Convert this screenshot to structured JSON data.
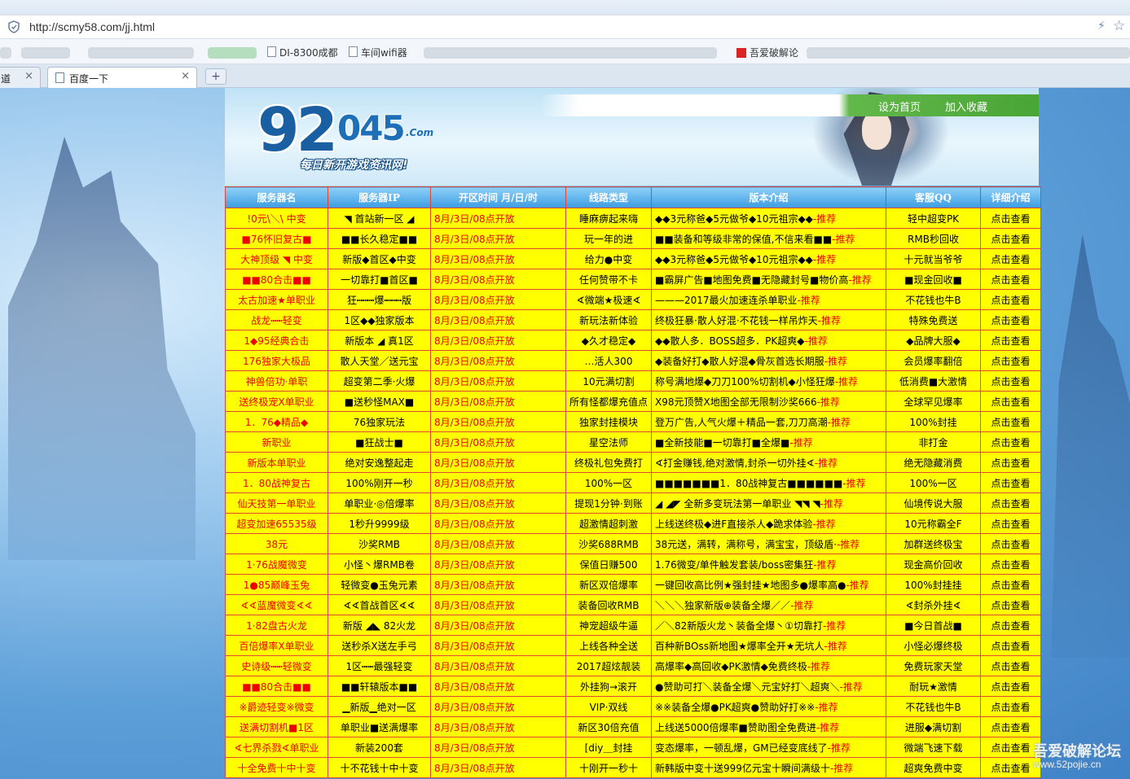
{
  "browser": {
    "url": "http://scmy58.com/jj.html",
    "bookmarks": [
      "DI-8300成都",
      "车间wifi器",
      "吾爱破解论"
    ],
    "tab_prev_label": "道",
    "tab_active_label": "百度一下",
    "new_tab": "+",
    "close": "×"
  },
  "site": {
    "logo_main": "92",
    "logo_num": "045",
    "logo_com": ".Com",
    "slogan": "每日新开游戏资讯网!",
    "nav": [
      "设为首页",
      "加入收藏"
    ]
  },
  "table": {
    "headers": [
      "服务器名",
      "服务器IP",
      "开区时间 月/日/时",
      "线路类型",
      "版本介绍",
      "客服QQ",
      "详细介绍"
    ],
    "rec_suffix": "-推荐",
    "rows": [
      [
        "!0元\\＼\\ 中变",
        "◥ 首站新一区 ◢",
        "8月/3日/08点开放",
        "睡麻痹起来嗨",
        "◆◆3元称爸◆5元做爷◆10元祖宗◆◆",
        "轻中超变PK",
        "点击查看"
      ],
      [
        "■76怀旧复古■",
        "■■长久稳定■■",
        "8月/3日/08点开放",
        "玩一年的进",
        "■■装备和等级非常的保值,不信来看■■",
        "RMB秒回收",
        "点击查看"
      ],
      [
        "大神顶级 ◥ 中变",
        "新版◆首区◆中变",
        "8月/3日/08点开放",
        "给力●中变",
        "◆◆3元称爸◆5元做爷◆10元祖宗◆◆",
        "十元就当爷爷",
        "点击查看"
      ],
      [
        "■■80合击■■",
        "一切靠打■首区■",
        "8月/3日/08点开放",
        "任何赞带不卡",
        "■霸屏广告■地图免费■无隐藏封号■物价高",
        "■现金回收■",
        "点击查看"
      ],
      [
        "太古加速★单职业",
        "狂┅┅┅爆┅┅┅版",
        "8月/3日/08点开放",
        "∢微端★极速∢",
        "———2017最火加速连杀单职业",
        "不花钱也牛B",
        "点击查看"
      ],
      [
        "战龙┅┅轻变",
        "1区◆◆独家版本",
        "8月/3日/08点开放",
        "新玩法新体验",
        "终极狂暴·散人好混·不花钱一样吊炸天",
        "特殊免费送",
        "点击查看"
      ],
      [
        "1◆95经典合击",
        "新版本 ◢ 真1区",
        "8月/3日/08点开放",
        "◆久才稳定◆",
        "◆◆散人多．BOSS超多．PK超爽◆",
        "◆品牌大服◆",
        "点击查看"
      ],
      [
        "176独家大极品",
        "散人天堂／送元宝",
        "8月/3日/08点开放",
        "…活人300",
        "◆装备好打◆散人好混◆骨灰首选长期服",
        "会员爆率翻倍",
        "点击查看"
      ],
      [
        "神兽倍功·单职",
        "超变第二季·火爆",
        "8月/3日/08点开放",
        "10元满切割",
        "称号满地爆◆刀刀100%切割机◆小怪狂爆",
        "低消费■大激情",
        "点击查看"
      ],
      [
        "送终极宠X单职业",
        "■送秒怪MAX■",
        "8月/3日/08点开放",
        "所有怪都爆充值点",
        "X98元顶赞X地图全部无限制沙奖666",
        "全球罕见爆率",
        "点击查看"
      ],
      [
        "1．76◆精品◆",
        "76独家玩法",
        "8月/3日/08点开放",
        "独家封挂模块",
        "登万广告,人气火爆＋精品一套,刀刀高潮",
        "100%封挂",
        "点击查看"
      ],
      [
        "新职业",
        "■狂战士■",
        "8月/3日/08点开放",
        "星空法师",
        "■全新技能■一切靠打■全爆■",
        "非打金",
        "点击查看"
      ],
      [
        "新版本单职业",
        "绝对安逸整起走",
        "8月/3日/08点开放",
        "终极礼包免费打",
        "∢打金赚钱,绝对激情,封杀一切外挂∢",
        "绝无隐藏消费",
        "点击查看"
      ],
      [
        "1．80战神复古",
        "100%刚开一秒",
        "8月/3日/08点开放",
        "100%一区",
        "■■■■■■■1．80战神复古■■■■■■",
        "100%一区",
        "点击查看"
      ],
      [
        "仙天技第一单职业",
        "单职业·◎倍爆率",
        "8月/3日/08点开放",
        "提现1分钟·到账",
        "◢ ◢◤ 全新多变玩法第一单职业 ◥◥ ◥",
        "仙境传说大服",
        "点击查看"
      ],
      [
        "超变加速65535级",
        "1秒升9999级",
        "8月/3日/08点开放",
        "超激情超刺激",
        "上线送终极◆进F直接杀人◆跪求体验",
        "10元称霸全F",
        "点击查看"
      ],
      [
        "38元",
        "沙奖RMB",
        "8月/3日/08点开放",
        "沙奖688RMB",
        "38元送，满转，满称号，满宝宝，顶级盾·",
        "加群送终极宝",
        "点击查看"
      ],
      [
        "1·76战魔微变",
        "小怪丶爆RMB卷",
        "8月/3日/08点开放",
        "保值日赚500",
        "1.76微变/单件触发套装/boss密集狂",
        "现金高价回收",
        "点击查看"
      ],
      [
        "1●85巅峰玉兔",
        "轻微变●玉兔元素",
        "8月/3日/08点开放",
        "新区双倍爆率",
        "一键回收高比例★强封挂★地图多●爆率高●",
        "100%封挂挂",
        "点击查看"
      ],
      [
        "∢∢蓝魔微变∢∢",
        "∢∢首战首区∢∢",
        "8月/3日/08点开放",
        "装备回收RMB",
        "＼＼＼独家新版⊕装备全爆／／",
        "∢封杀外挂∢",
        "点击查看"
      ],
      [
        "1·82盘古火龙",
        "新版 ◢◣ 82火龙",
        "8月/3日/08点开放",
        "神宠超级牛逼",
        "／＼82新版火龙丶装备全爆丶①切靠打",
        "■今日首战■",
        "点击查看"
      ],
      [
        "百倍爆率X单职业",
        "送秒杀X送左手弓",
        "8月/3日/08点开放",
        "上线各种全送",
        "百种新BOss新地图★爆率全开★无坑人",
        "小怪必爆终极",
        "点击查看"
      ],
      [
        "史诗级┅┅轻微变",
        "1区┅┅最强轻变",
        "8月/3日/08点开放",
        "2017超炫靓装",
        "高爆率◆高回收◆PK激情◆免费终极",
        "免费玩家天堂",
        "点击查看"
      ],
      [
        "■■80合击■■",
        "■■轩辕版本■■",
        "8月/3日/08点开放",
        "外挂狗→滚开",
        "●赞助可打＼装备全爆＼元宝好打＼超爽＼",
        "耐玩★激情",
        "点击查看"
      ],
      [
        "※爵迹轻变※微变",
        "▁新版▁绝对一区",
        "8月/3日/08点开放",
        "VIP·双线",
        "※※装备全爆●PK超爽●赞助好打※※",
        "不花钱也牛B",
        "点击查看"
      ],
      [
        "送满切割机■1区",
        "单职业■送满爆率",
        "8月/3日/08点开放",
        "新区30倍充值",
        "上线送5000倍爆率■赞助图全免费进",
        "进服◆满切割",
        "点击查看"
      ],
      [
        "∢七界杀戮∢单职业",
        "新装200套",
        "8月/3日/08点开放",
        "[diy＿封挂",
        "变态爆率，一顿乱爆，GM已经变底线了",
        "微端飞速下载",
        "点击查看"
      ],
      [
        "十全免费十中十变",
        "十不花钱十中十变",
        "8月/3日/08点开放",
        "十刚开一秒十",
        "新韩版中变十送999亿元宝十瞬间满级十",
        "超爽免费中变",
        "点击查看"
      ]
    ]
  },
  "watermark": {
    "line1": "吾爱破解论坛",
    "line2": "www.52pojie.cn"
  }
}
